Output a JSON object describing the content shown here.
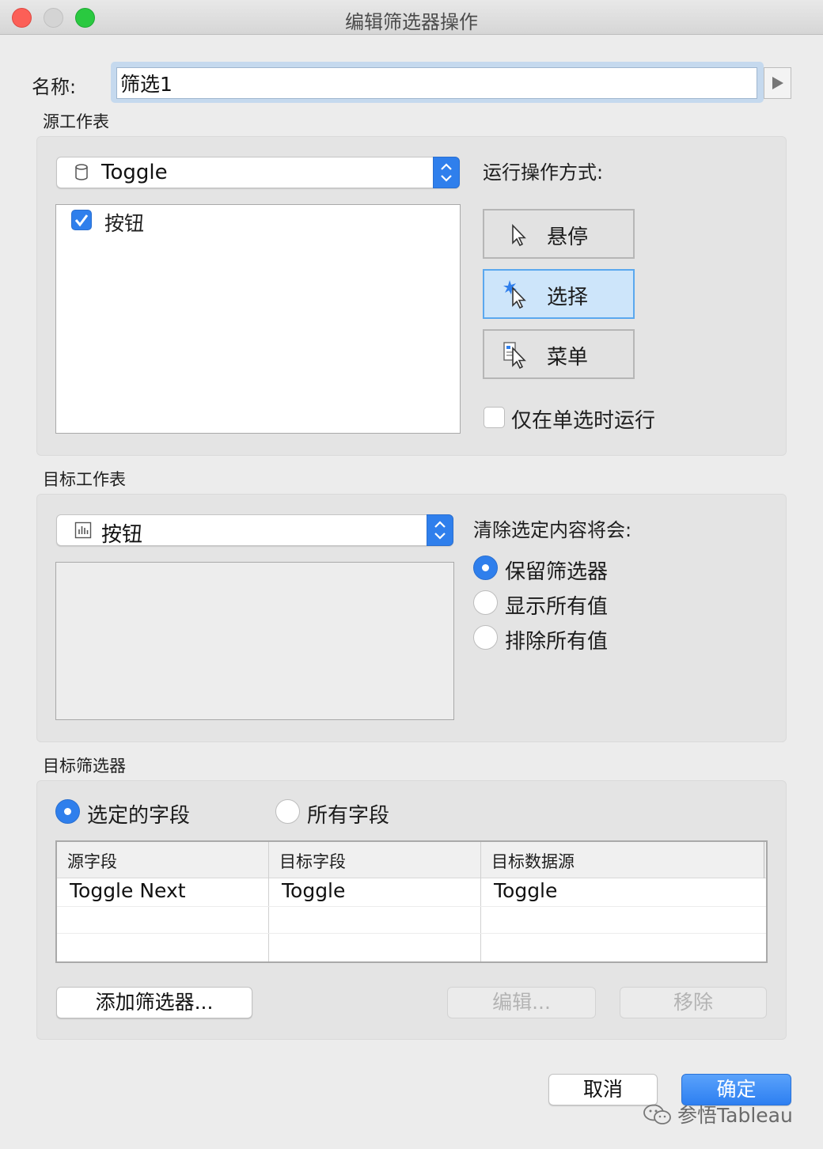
{
  "window": {
    "title": "编辑筛选器操作"
  },
  "name": {
    "label": "名称:",
    "value": "筛选1"
  },
  "source": {
    "section_label": "源工作表",
    "datasource": "Toggle",
    "sheets": [
      {
        "label": "按钮",
        "checked": true
      }
    ],
    "run_label": "运行操作方式:",
    "modes": [
      {
        "label": "悬停",
        "icon": "hover-pointer-icon",
        "active": false
      },
      {
        "label": "选择",
        "icon": "select-pointer-icon",
        "active": true
      },
      {
        "label": "菜单",
        "icon": "menu-pointer-icon",
        "active": false
      }
    ],
    "single_select": {
      "label": "仅在单选时运行",
      "checked": false
    }
  },
  "target": {
    "section_label": "目标工作表",
    "sheet": "按钮",
    "clear_label": "清除选定内容将会:",
    "clear_options": [
      {
        "label": "保留筛选器",
        "selected": true
      },
      {
        "label": "显示所有值",
        "selected": false
      },
      {
        "label": "排除所有值",
        "selected": false
      }
    ]
  },
  "filters": {
    "section_label": "目标筛选器",
    "scope_options": [
      {
        "label": "选定的字段",
        "selected": true
      },
      {
        "label": "所有字段",
        "selected": false
      }
    ],
    "columns": [
      "源字段",
      "目标字段",
      "目标数据源"
    ],
    "rows": [
      [
        "Toggle Next",
        "Toggle",
        "Toggle"
      ]
    ],
    "add_button": "添加筛选器...",
    "edit_button": "编辑...",
    "remove_button": "移除"
  },
  "footer": {
    "cancel": "取消",
    "ok": "确定"
  },
  "watermark": {
    "text": "参悟Tableau"
  },
  "colors": {
    "accent": "#2f7fec",
    "active_mode_bg": "#cde5fa"
  }
}
